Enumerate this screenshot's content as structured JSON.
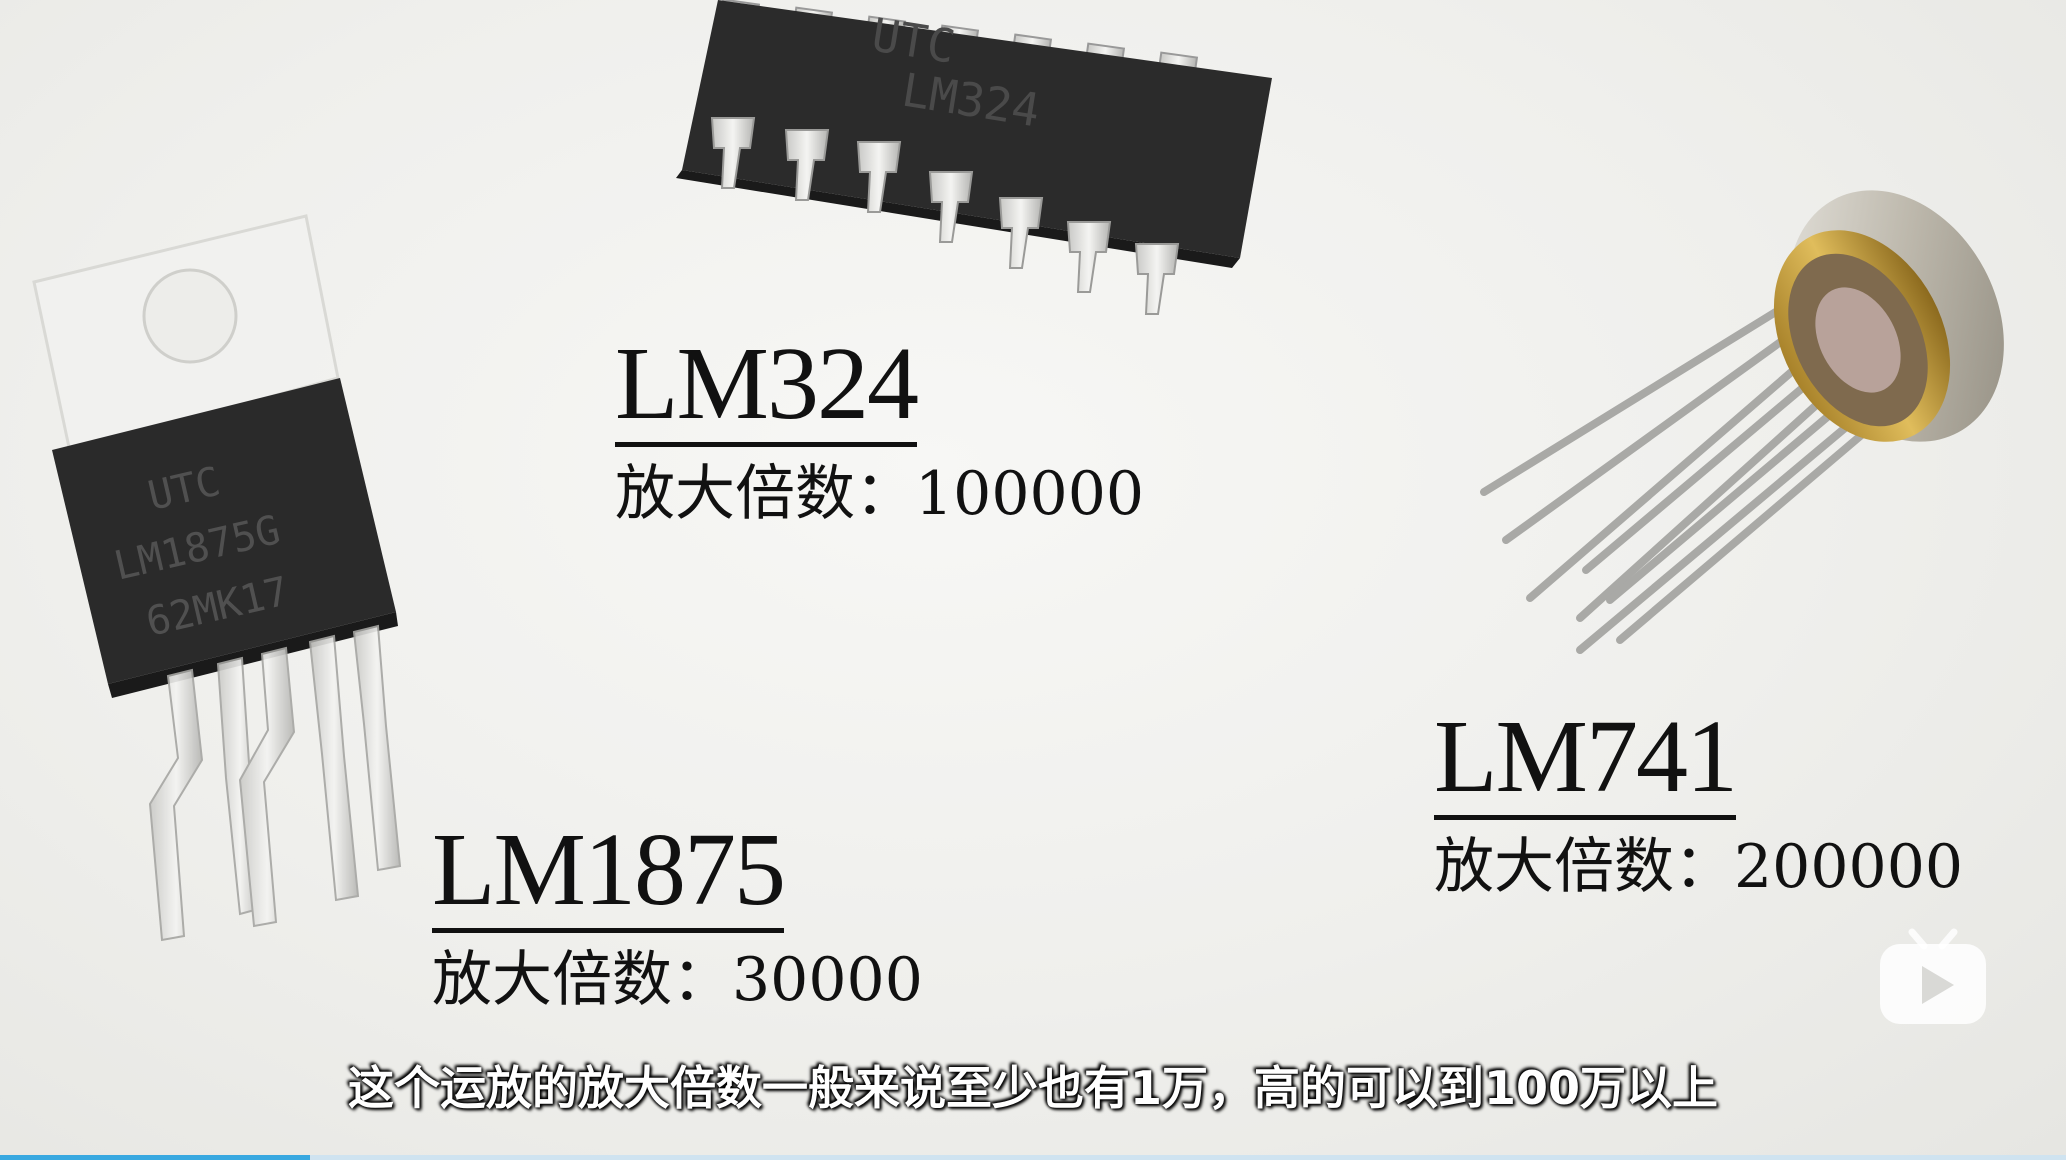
{
  "labels": [
    {
      "name": "LM324",
      "gain_prefix": "放大倍数：",
      "gain_value": "100000"
    },
    {
      "name": "LM1875",
      "gain_prefix": "放大倍数：",
      "gain_value": "30000"
    },
    {
      "name": "LM741",
      "gain_prefix": "放大倍数：",
      "gain_value": "200000"
    }
  ],
  "chip_markings": {
    "lm1875_line1": "UTC",
    "lm1875_line2": "LM1875G",
    "lm1875_line3": "62MK17",
    "dip_line1": "UTC",
    "dip_line2": "LM324"
  },
  "subtitle": "这个运放的放大倍数一般来说至少也有1万，高的可以到100万以上",
  "watermark_icon": "bilibili-tv-icon",
  "progress": {
    "fraction": 0.15
  },
  "colors": {
    "background": "#f1f1ee",
    "chip_body": "#2b2b2b",
    "label_text": "#111111",
    "subtitle_text": "#ffffff",
    "progress_fill": "#38a8e0"
  }
}
